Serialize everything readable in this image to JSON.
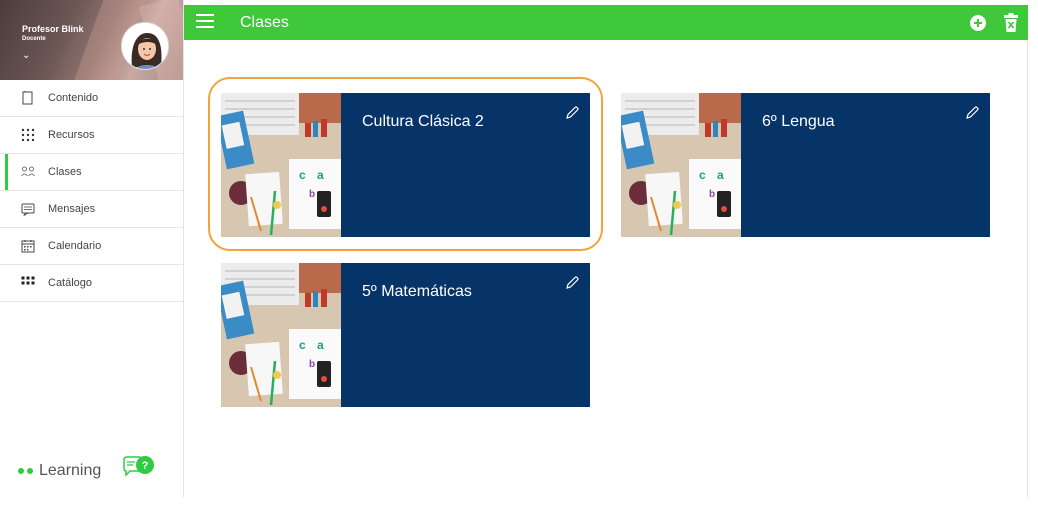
{
  "profile": {
    "name": "Profesor Blink",
    "role": "Docente"
  },
  "header": {
    "title": "Clases"
  },
  "sidebar": {
    "items": [
      {
        "label": "Contenido",
        "icon": "document-icon"
      },
      {
        "label": "Recursos",
        "icon": "grid-dots-icon"
      },
      {
        "label": "Clases",
        "icon": "people-icon",
        "active": true
      },
      {
        "label": "Mensajes",
        "icon": "message-icon"
      },
      {
        "label": "Calendario",
        "icon": "calendar-icon"
      },
      {
        "label": "Catálogo",
        "icon": "catalog-grid-icon"
      }
    ]
  },
  "brand": {
    "text": "Learning"
  },
  "classes": [
    {
      "title": "Cultura Clásica 2",
      "selected": true
    },
    {
      "title": "6º Lengua"
    },
    {
      "title": "5º Matemáticas"
    }
  ],
  "colors": {
    "accent": "#3ec83a",
    "card": "#063468",
    "highlight": "#f0a43a"
  }
}
